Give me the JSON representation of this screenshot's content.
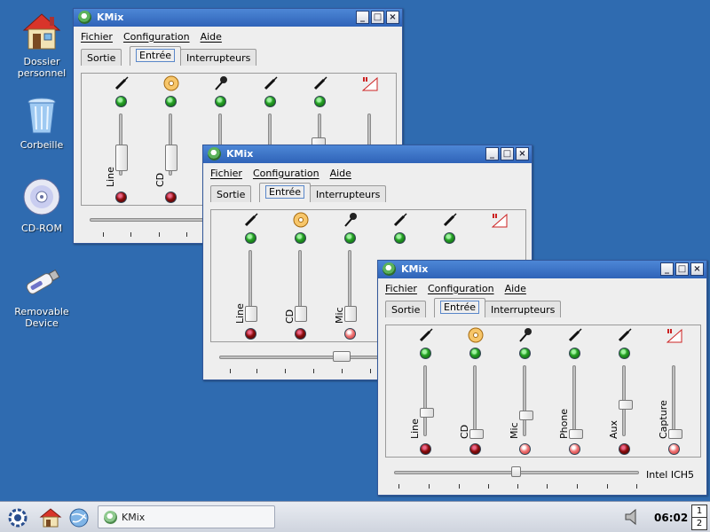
{
  "desktop": {
    "icons": [
      {
        "label_line1": "Dossier",
        "label_line2": "personnel"
      },
      {
        "label_line1": "Corbeille",
        "label_line2": ""
      },
      {
        "label_line1": "CD-ROM",
        "label_line2": ""
      },
      {
        "label_line1": "Removable",
        "label_line2": "Device"
      }
    ]
  },
  "window": {
    "title": "KMix",
    "menu": {
      "file": "Fichier",
      "config": "Configuration",
      "help": "Aide"
    },
    "tabs": {
      "output": "Sortie",
      "input": "Entrée",
      "switches": "Interrupteurs"
    },
    "channels": [
      "Line",
      "CD",
      "Mic",
      "Phone",
      "Aux",
      "Capture"
    ],
    "device_name": "Intel ICH5"
  },
  "taskbar": {
    "task_label": "KMix",
    "clock": "06:02",
    "pager": [
      "1",
      "2"
    ]
  }
}
